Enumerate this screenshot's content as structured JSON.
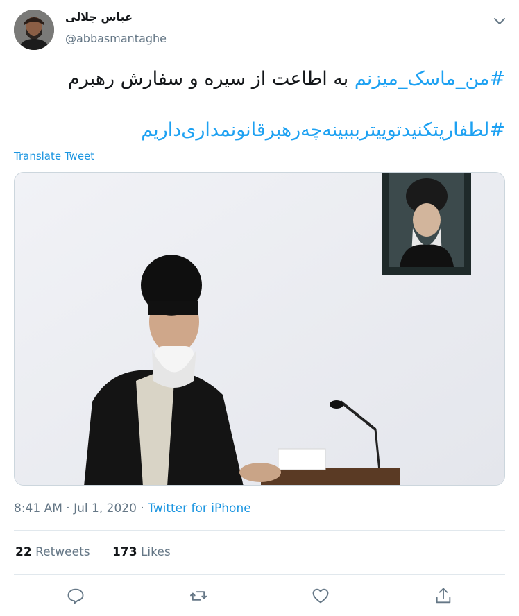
{
  "author": {
    "name": "عباس جلالی",
    "handle": "@abbasmantaghe"
  },
  "tweet": {
    "line1_hashtag": "#من_ماسک_میزنم",
    "line1_text": " به اطاعت از سیره و سفارش رهبرم",
    "line2_hashtag": "#لطفاریتکنیدتوییتربببینه‌چه‌رهبرقانونمداری‌داریم",
    "translate_label": "Translate Tweet"
  },
  "meta": {
    "time": "8:41 AM",
    "date": "Jul 1, 2020",
    "separator": "·",
    "source": "Twitter for iPhone"
  },
  "stats": {
    "retweets_count": "22",
    "retweets_label": "Retweets",
    "likes_count": "173",
    "likes_label": "Likes"
  },
  "icons": {
    "caret": "chevron-down-icon",
    "reply": "reply-icon",
    "retweet": "retweet-icon",
    "like": "heart-icon",
    "share": "share-icon"
  },
  "colors": {
    "accent": "#1da1f2",
    "link": "#1b95e0",
    "muted": "#657786",
    "border": "#e1e8ed"
  }
}
